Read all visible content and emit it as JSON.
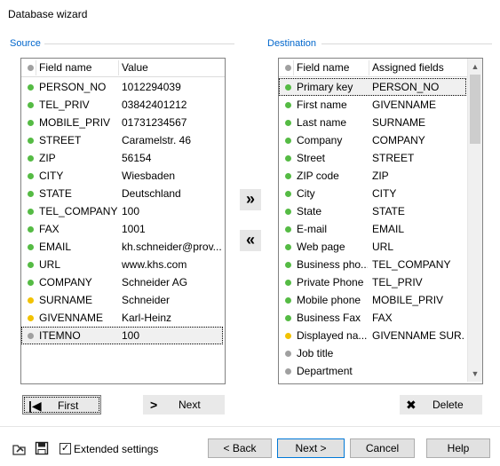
{
  "window": {
    "title": "Database wizard"
  },
  "colors": {
    "green": "#55bb44",
    "yellow": "#f2c200",
    "gray": "#a0a0a0",
    "accent": "#0066cc"
  },
  "source": {
    "label": "Source",
    "headers": {
      "field": "Field name",
      "value": "Value"
    },
    "rows": [
      {
        "field": "PERSON_NO",
        "value": "1012294039",
        "status": "green"
      },
      {
        "field": "TEL_PRIV",
        "value": "03842401212",
        "status": "green"
      },
      {
        "field": "MOBILE_PRIV",
        "value": "01731234567",
        "status": "green"
      },
      {
        "field": "STREET",
        "value": "Caramelstr. 46",
        "status": "green"
      },
      {
        "field": "ZIP",
        "value": "56154",
        "status": "green"
      },
      {
        "field": "CITY",
        "value": "Wiesbaden",
        "status": "green"
      },
      {
        "field": "STATE",
        "value": "Deutschland",
        "status": "green"
      },
      {
        "field": "TEL_COMPANY",
        "value": "100",
        "status": "green"
      },
      {
        "field": "FAX",
        "value": "1001",
        "status": "green"
      },
      {
        "field": "EMAIL",
        "value": "kh.schneider@prov...",
        "status": "green"
      },
      {
        "field": "URL",
        "value": "www.khs.com",
        "status": "green"
      },
      {
        "field": "COMPANY",
        "value": "Schneider AG",
        "status": "green"
      },
      {
        "field": "SURNAME",
        "value": "Schneider",
        "status": "yellow"
      },
      {
        "field": "GIVENNAME",
        "value": "Karl-Heinz",
        "status": "yellow"
      },
      {
        "field": "ITEMNO",
        "value": "100",
        "status": "gray",
        "selected": true
      }
    ]
  },
  "destination": {
    "label": "Destination",
    "headers": {
      "field": "Field name",
      "value": "Assigned fields"
    },
    "rows": [
      {
        "field": "Primary key",
        "value": "PERSON_NO",
        "status": "green",
        "selected": true
      },
      {
        "field": "First name",
        "value": "GIVENNAME",
        "status": "green"
      },
      {
        "field": "Last name",
        "value": "SURNAME",
        "status": "green"
      },
      {
        "field": "Company",
        "value": "COMPANY",
        "status": "green"
      },
      {
        "field": "Street",
        "value": "STREET",
        "status": "green"
      },
      {
        "field": "ZIP code",
        "value": "ZIP",
        "status": "green"
      },
      {
        "field": "City",
        "value": "CITY",
        "status": "green"
      },
      {
        "field": "State",
        "value": "STATE",
        "status": "green"
      },
      {
        "field": "E-mail",
        "value": "EMAIL",
        "status": "green"
      },
      {
        "field": "Web page",
        "value": "URL",
        "status": "green"
      },
      {
        "field": "Business pho...",
        "value": "TEL_COMPANY",
        "status": "green"
      },
      {
        "field": "Private Phone",
        "value": "TEL_PRIV",
        "status": "green"
      },
      {
        "field": "Mobile phone",
        "value": "MOBILE_PRIV",
        "status": "green"
      },
      {
        "field": "Business Fax",
        "value": "FAX",
        "status": "green"
      },
      {
        "field": "Displayed na...",
        "value": "GIVENNAME SUR...",
        "status": "yellow"
      },
      {
        "field": "Job title",
        "value": "",
        "status": "gray"
      },
      {
        "field": "Department",
        "value": "",
        "status": "gray"
      }
    ]
  },
  "buttons": {
    "assign": "»",
    "unassign": "«",
    "first": "First",
    "next_record": "Next",
    "delete": "Delete",
    "back": "< Back",
    "next": "Next >",
    "cancel": "Cancel",
    "help": "Help"
  },
  "extended_settings": {
    "label": "Extended settings",
    "checked": true
  }
}
